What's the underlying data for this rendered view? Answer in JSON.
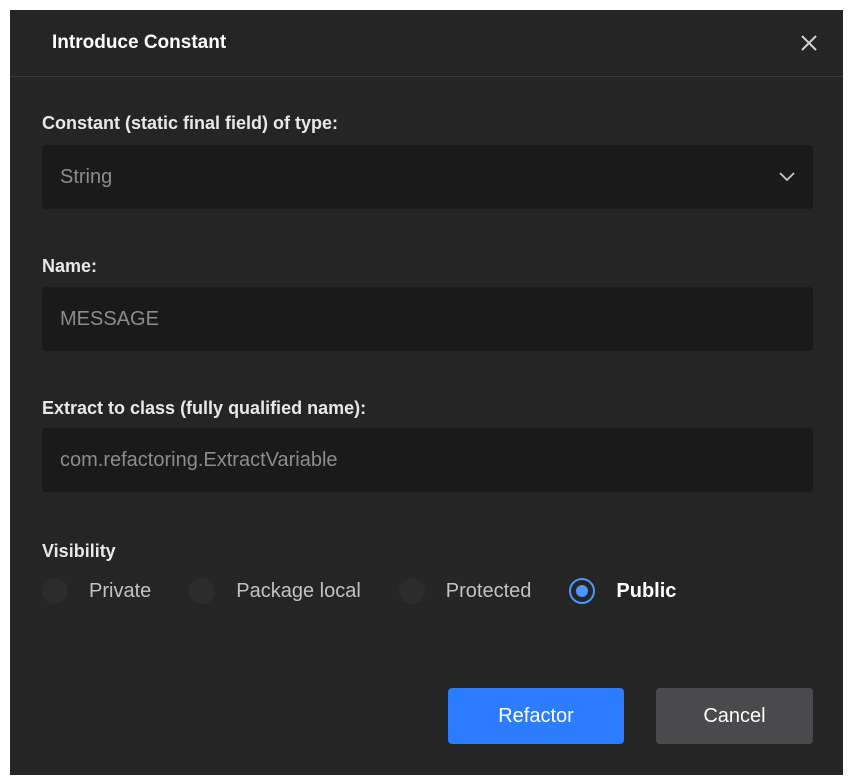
{
  "dialog": {
    "title": "Introduce Constant"
  },
  "type_field": {
    "label": "Constant (static final field) of type:",
    "value": "String"
  },
  "name_field": {
    "label": "Name:",
    "value": "MESSAGE"
  },
  "class_field": {
    "label": "Extract to class (fully qualified name):",
    "value": "com.refactoring.ExtractVariable"
  },
  "visibility": {
    "label": "Visibility",
    "options": [
      {
        "label": "Private",
        "selected": false
      },
      {
        "label": "Package local",
        "selected": false
      },
      {
        "label": "Protected",
        "selected": false
      },
      {
        "label": "Public",
        "selected": true
      }
    ]
  },
  "buttons": {
    "refactor": "Refactor",
    "cancel": "Cancel"
  },
  "colors": {
    "accent": "#2b7cff",
    "background": "#252526",
    "field_bg": "#1a1a1b"
  }
}
